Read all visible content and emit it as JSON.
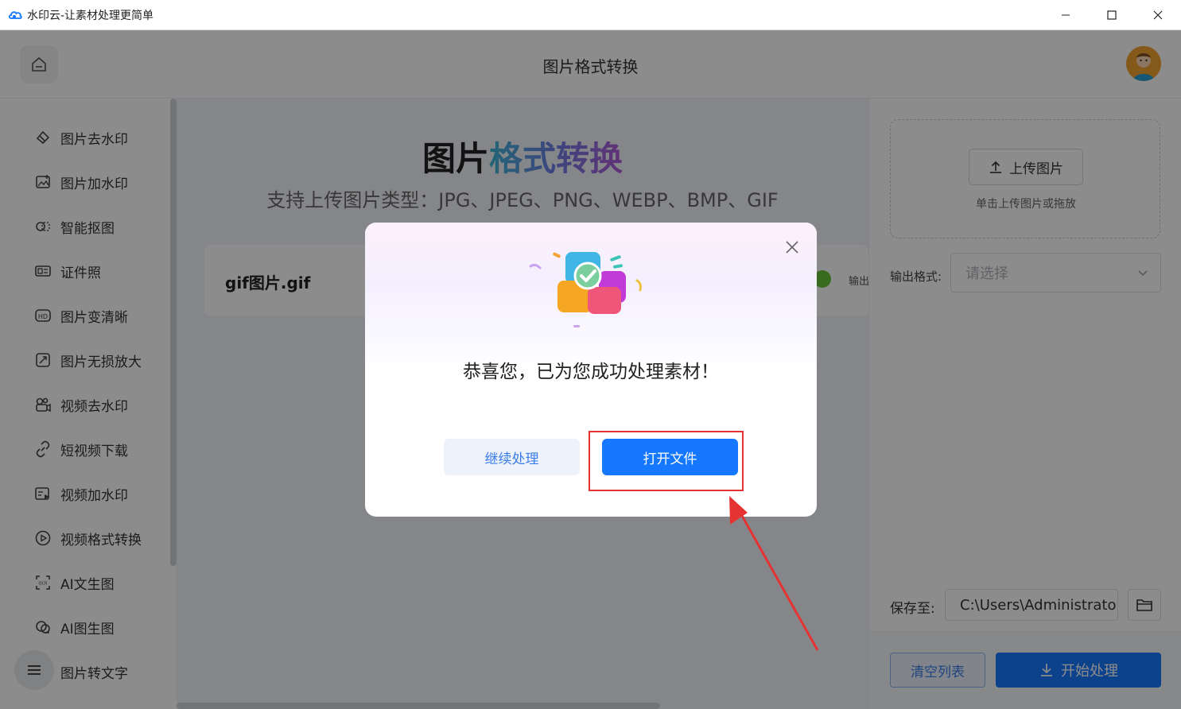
{
  "window": {
    "title": "水印云-让素材处理更简单",
    "minimize_icon": "minimize-icon",
    "maximize_icon": "maximize-icon",
    "close_icon": "close-icon"
  },
  "header": {
    "title": "图片格式转换"
  },
  "sidebar": {
    "items": [
      {
        "label": "图片去水印",
        "icon": "eraser-icon"
      },
      {
        "label": "图片加水印",
        "icon": "image-add-icon"
      },
      {
        "label": "智能抠图",
        "icon": "cutout-icon"
      },
      {
        "label": "证件照",
        "icon": "id-card-icon"
      },
      {
        "label": "图片变清晰",
        "icon": "hd-icon"
      },
      {
        "label": "图片无损放大",
        "icon": "enlarge-icon"
      },
      {
        "label": "视频去水印",
        "icon": "video-eraser-icon"
      },
      {
        "label": "短视频下载",
        "icon": "link-icon"
      },
      {
        "label": "视频加水印",
        "icon": "video-add-icon"
      },
      {
        "label": "视频格式转换",
        "icon": "play-circle-icon"
      },
      {
        "label": "AI文生图",
        "icon": "ocr-icon"
      },
      {
        "label": "AI图生图",
        "icon": "ai-image-icon"
      },
      {
        "label": "图片转文字",
        "icon": "text-icon"
      }
    ]
  },
  "main": {
    "title_plain": "图片",
    "title_gradient": "格式转换",
    "subtitle": "支持上传图片类型：JPG、JPEG、PNG、WEBP、BMP、GIF",
    "file": {
      "name": "gif图片.gif",
      "output_label": "输出"
    }
  },
  "right_panel": {
    "upload_label": "上传图片",
    "upload_hint": "单击上传图片或拖放",
    "format_label": "输出格式:",
    "format_placeholder": "请选择",
    "save_label": "保存至:",
    "save_path": "C:\\Users\\Administrator",
    "clear_label": "清空列表",
    "start_label": "开始处理"
  },
  "dialog": {
    "message": "恭喜您，已为您成功处理素材！",
    "continue_label": "继续处理",
    "open_label": "打开文件"
  },
  "colors": {
    "primary": "#1677ff",
    "annotation": "#e53333",
    "success": "#67c23a"
  }
}
